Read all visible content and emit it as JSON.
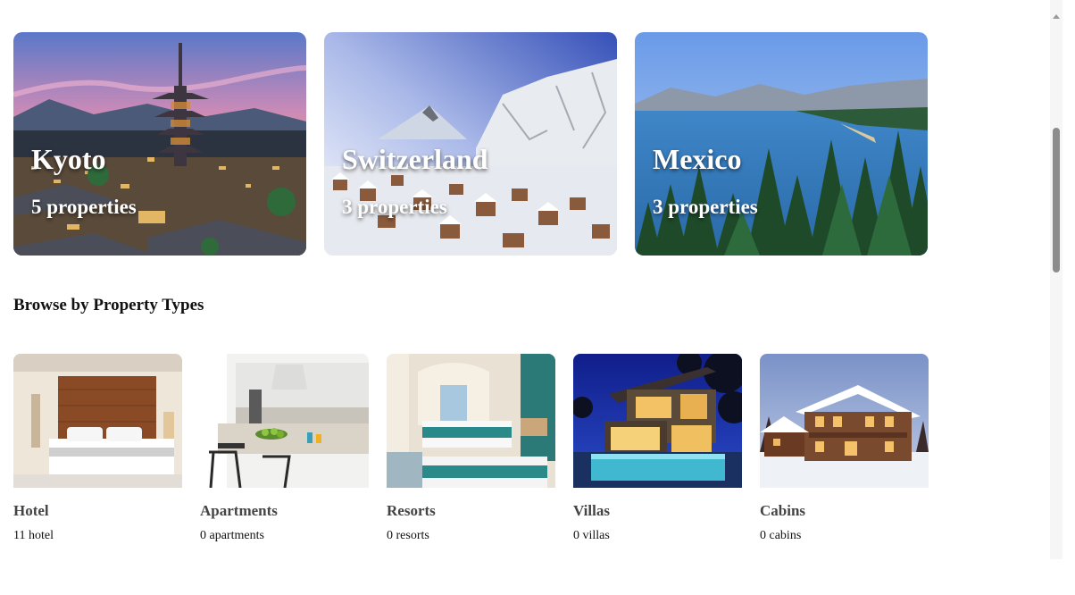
{
  "destinations": [
    {
      "name": "Kyoto",
      "count": "5 properties"
    },
    {
      "name": "Switzerland",
      "count": "3 properties"
    },
    {
      "name": "Mexico",
      "count": "3 properties"
    }
  ],
  "property_section": {
    "title": "Browse by Property Types",
    "types": [
      {
        "name": "Hotel",
        "count": "11 hotel"
      },
      {
        "name": "Apartments",
        "count": "0 apartments"
      },
      {
        "name": "Resorts",
        "count": "0 resorts"
      },
      {
        "name": "Villas",
        "count": "0 villas"
      },
      {
        "name": "Cabins",
        "count": "0 cabins"
      }
    ]
  }
}
